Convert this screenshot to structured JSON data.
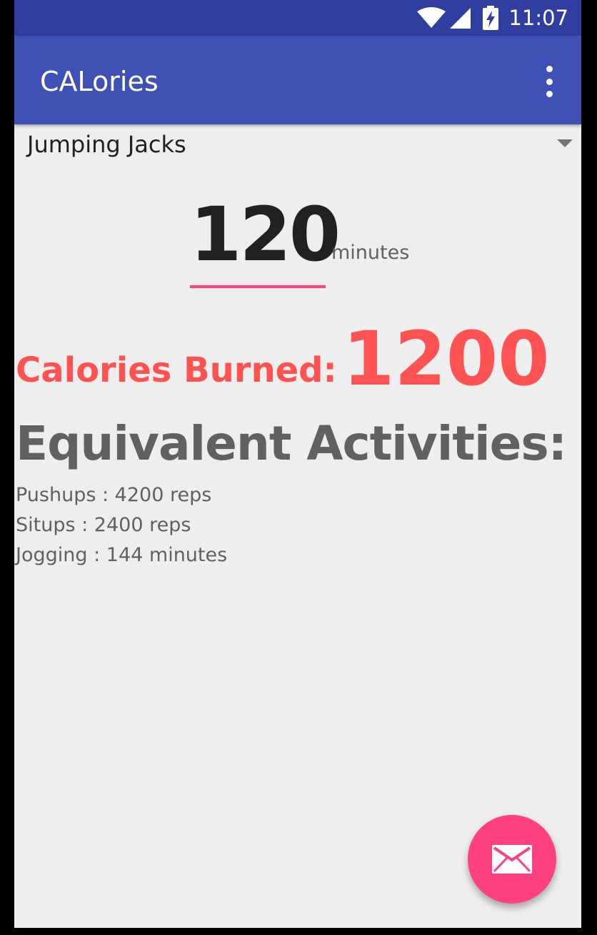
{
  "status_bar": {
    "time": "11:07",
    "icons": [
      "wifi-icon",
      "cell-signal-icon",
      "battery-charging-icon"
    ]
  },
  "app_bar": {
    "title": "CALories",
    "menu_icon": "overflow-menu-icon"
  },
  "activity_spinner": {
    "selected": "Jumping Jacks"
  },
  "duration": {
    "value": "120",
    "unit": "minutes"
  },
  "calories": {
    "label": "Calories Burned:",
    "value": "1200"
  },
  "equivalents": {
    "heading": "Equivalent Activities:",
    "items": [
      "Pushups : 4200 reps",
      "Situps : 2400 reps",
      "Jogging : 144 minutes"
    ]
  },
  "fab": {
    "icon": "email-icon"
  },
  "colors": {
    "status_bar": "#303f9f",
    "app_bar": "#3f51b5",
    "accent": "#ff4081",
    "calories": "#ff5252",
    "background": "#eeeeee"
  }
}
